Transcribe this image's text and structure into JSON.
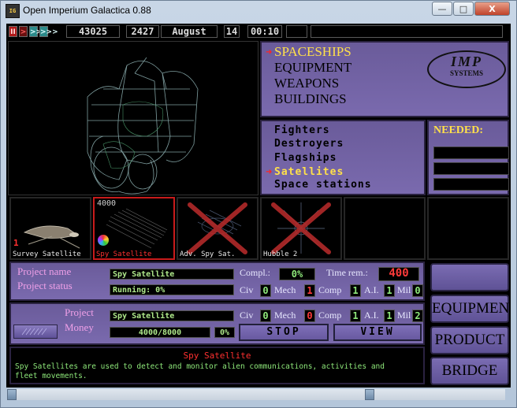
{
  "window": {
    "title": "Open Imperium Galactica 0.88",
    "icon_text": "IG",
    "controls": {
      "minimize": "—",
      "maximize": "□",
      "close": "X"
    }
  },
  "status_bar": {
    "speed_buttons": [
      "II",
      ">",
      ">>",
      ">>>"
    ],
    "money": "43025",
    "planets": "2427",
    "month": "August",
    "day": "14",
    "time": "00:10"
  },
  "categories": [
    "SPACESHIPS",
    "EQUIPMENT",
    "WEAPONS",
    "BUILDINGS"
  ],
  "selected_category": "SPACESHIPS",
  "logo": {
    "line1": "IMP",
    "line2": "SYSTEMS"
  },
  "subcategories": [
    "Fighters",
    "Destroyers",
    "Flagships",
    "Satellites",
    "Space stations"
  ],
  "selected_subcategory": "Satellites",
  "needed": {
    "title": "NEEDED:"
  },
  "items": [
    {
      "name": "Survey Satellite",
      "count": "1",
      "cost": "",
      "available": true,
      "selected": false
    },
    {
      "name": "Spy Satellite",
      "count": "",
      "cost": "4000",
      "available": true,
      "selected": true
    },
    {
      "name": "Adv. Spy Sat.",
      "count": "",
      "cost": "",
      "available": false,
      "selected": false
    },
    {
      "name": "Hubble 2",
      "count": "",
      "cost": "",
      "available": false,
      "selected": false
    }
  ],
  "project": {
    "name_label": "Project name",
    "name": "Spy Satellite",
    "status_label": "Project status",
    "status": "Running: 0%",
    "completion_label": "Compl.:",
    "completion": "0%",
    "time_label": "Time rem.:",
    "time_remaining": "400",
    "civ_label": "Civ",
    "civ": "0",
    "mech_label": "Mech",
    "mech": "1",
    "comp_label": "Comp",
    "comp": "1",
    "ai_label": "A.I.",
    "ai": "1",
    "mil_label": "Mil",
    "mil": "0"
  },
  "selection": {
    "project_label": "Project",
    "project": "Spy Satellite",
    "money_label": "Money",
    "money": "4000/8000",
    "percent": "0%",
    "civ_label": "Civ",
    "civ": "0",
    "mech_label": "Mech",
    "mech": "0",
    "comp_label": "Comp",
    "comp": "1",
    "ai_label": "A.I.",
    "ai": "1",
    "mil_label": "Mil",
    "mil": "2",
    "stop_label": "STOP",
    "view_label": "VIEW"
  },
  "description": {
    "title": "Spy Satellite",
    "text": "Spy Satellites are used to detect and monitor alien communications, activities and fleet movements."
  },
  "side_buttons": [
    "",
    "EQUIPMENT",
    "PRODUCT",
    "BRIDGE"
  ],
  "colors": {
    "accent": "#ffe04a",
    "panel": "#6a5b9a",
    "alert": "#ff3030",
    "digits": "#8ee87a"
  }
}
